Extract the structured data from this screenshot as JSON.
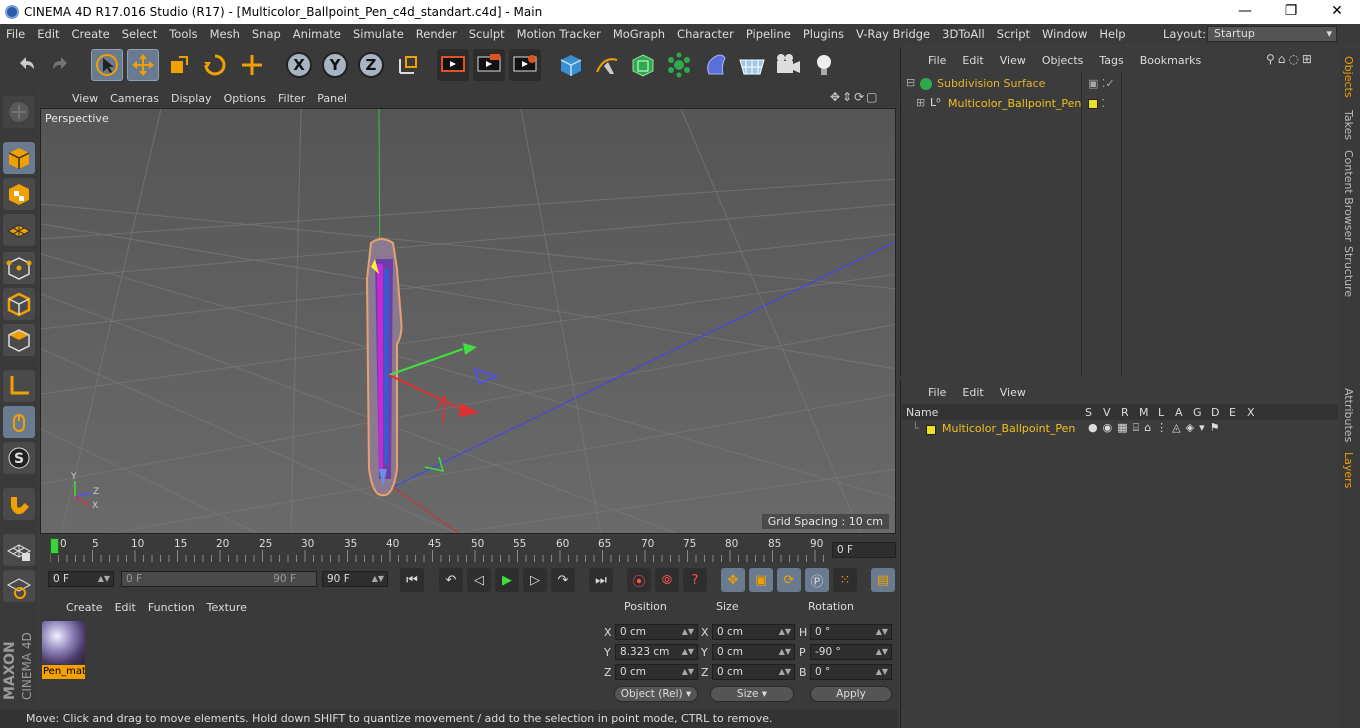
{
  "window": {
    "title": "CINEMA 4D R17.016 Studio (R17) - [Multicolor_Ballpoint_Pen_c4d_standart.c4d] - Main",
    "minimize": "—",
    "maximize": "❐",
    "close": "✕"
  },
  "menubar": [
    "File",
    "Edit",
    "Create",
    "Select",
    "Tools",
    "Mesh",
    "Snap",
    "Animate",
    "Simulate",
    "Render",
    "Sculpt",
    "Motion Tracker",
    "MoGraph",
    "Character",
    "Pipeline",
    "Plugins",
    "V-Ray Bridge",
    "3DToAll",
    "Script",
    "Window",
    "Help"
  ],
  "layout": {
    "label": "Layout:",
    "value": "Startup"
  },
  "toolbar": {
    "axis_x": "X",
    "axis_y": "Y",
    "axis_z": "Z"
  },
  "viewport": {
    "menu": [
      "View",
      "Cameras",
      "Display",
      "Options",
      "Filter",
      "Panel"
    ],
    "label": "Perspective",
    "grid_spacing": "Grid Spacing : 10 cm",
    "axis_y": "Y",
    "axis_x": "X",
    "axis_z": "Z"
  },
  "timeline": {
    "ticks": [
      "0",
      "5",
      "10",
      "15",
      "20",
      "25",
      "30",
      "35",
      "40",
      "45",
      "50",
      "55",
      "60",
      "65",
      "70",
      "75",
      "80",
      "85",
      "90"
    ],
    "current_frame": "0 F"
  },
  "transport": {
    "start_field": "0 F",
    "range_start": "0 F",
    "range_end": "90 F",
    "end_field": "90 F"
  },
  "materials": {
    "menu": [
      "Create",
      "Edit",
      "Function",
      "Texture"
    ],
    "items": [
      {
        "name": "Pen_mat"
      }
    ]
  },
  "coordinates": {
    "headers": {
      "position": "Position",
      "size": "Size",
      "rotation": "Rotation"
    },
    "pos": {
      "x": "0 cm",
      "y": "8.323 cm",
      "z": "0 cm"
    },
    "size": {
      "x": "0 cm",
      "y": "0 cm",
      "z": "0 cm"
    },
    "rot": {
      "h": "0 °",
      "p": "-90 °",
      "b": "0 °"
    },
    "labels": {
      "x": "X",
      "y": "Y",
      "z": "Z",
      "h": "H",
      "p": "P",
      "b": "B"
    },
    "mode": "Object (Rel)",
    "size_mode": "Size",
    "apply": "Apply"
  },
  "status": "Move: Click and drag to move elements. Hold down SHIFT to quantize movement / add to the selection in point mode, CTRL to remove.",
  "brand": {
    "maxon": "MAXON",
    "product": "CINEMA 4D"
  },
  "objects": {
    "menu": [
      "File",
      "Edit",
      "View",
      "Objects",
      "Tags",
      "Bookmarks"
    ],
    "rows": [
      {
        "name": "Subdivision Surface",
        "color": "#e3b52a"
      },
      {
        "name": "Multicolor_Ballpoint_Pen",
        "color": "#f0c020"
      }
    ]
  },
  "layers": {
    "menu": [
      "File",
      "Edit",
      "View"
    ],
    "columns": [
      "Name",
      "S",
      "V",
      "R",
      "M",
      "L",
      "A",
      "G",
      "D",
      "E",
      "X"
    ],
    "rows": [
      {
        "name": "Multicolor_Ballpoint_Pen",
        "color": "#e8e020"
      }
    ]
  },
  "sidetabs": [
    "Objects",
    "Takes",
    "Content Browser",
    "Structure",
    "Attributes",
    "Layers"
  ]
}
